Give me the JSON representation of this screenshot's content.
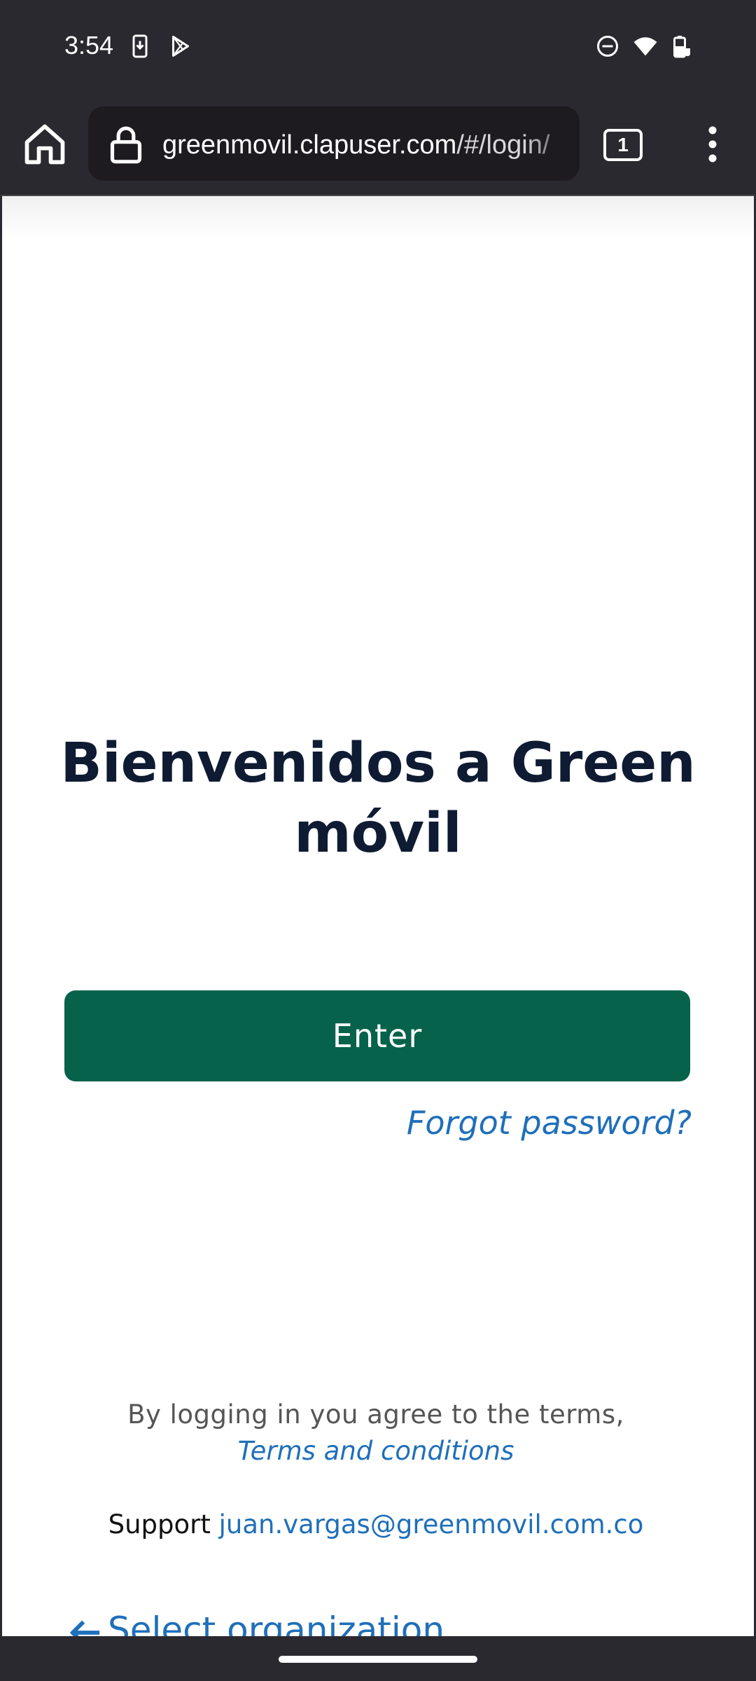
{
  "status_bar": {
    "time": "3:54",
    "icons": [
      "download-notification-icon",
      "play-store-icon",
      "do-not-disturb-icon",
      "wifi-icon",
      "battery-icon"
    ]
  },
  "browser": {
    "url_host": "greenmovil.clapuser.com",
    "url_path": "/#/login/",
    "tab_count": "1"
  },
  "page": {
    "welcome_title": "Bienvenidos a Green móvil",
    "enter_label": "Enter",
    "forgot_password": "Forgot password?",
    "terms_text": "By logging in you agree to the terms,",
    "terms_link": "Terms and conditions",
    "support_label": "Support",
    "support_email": "juan.vargas@greenmovil.com.co",
    "select_org": "Select organization"
  },
  "colors": {
    "primary_button": "#07624b",
    "link": "#1f6fba",
    "title": "#0e1b33"
  }
}
